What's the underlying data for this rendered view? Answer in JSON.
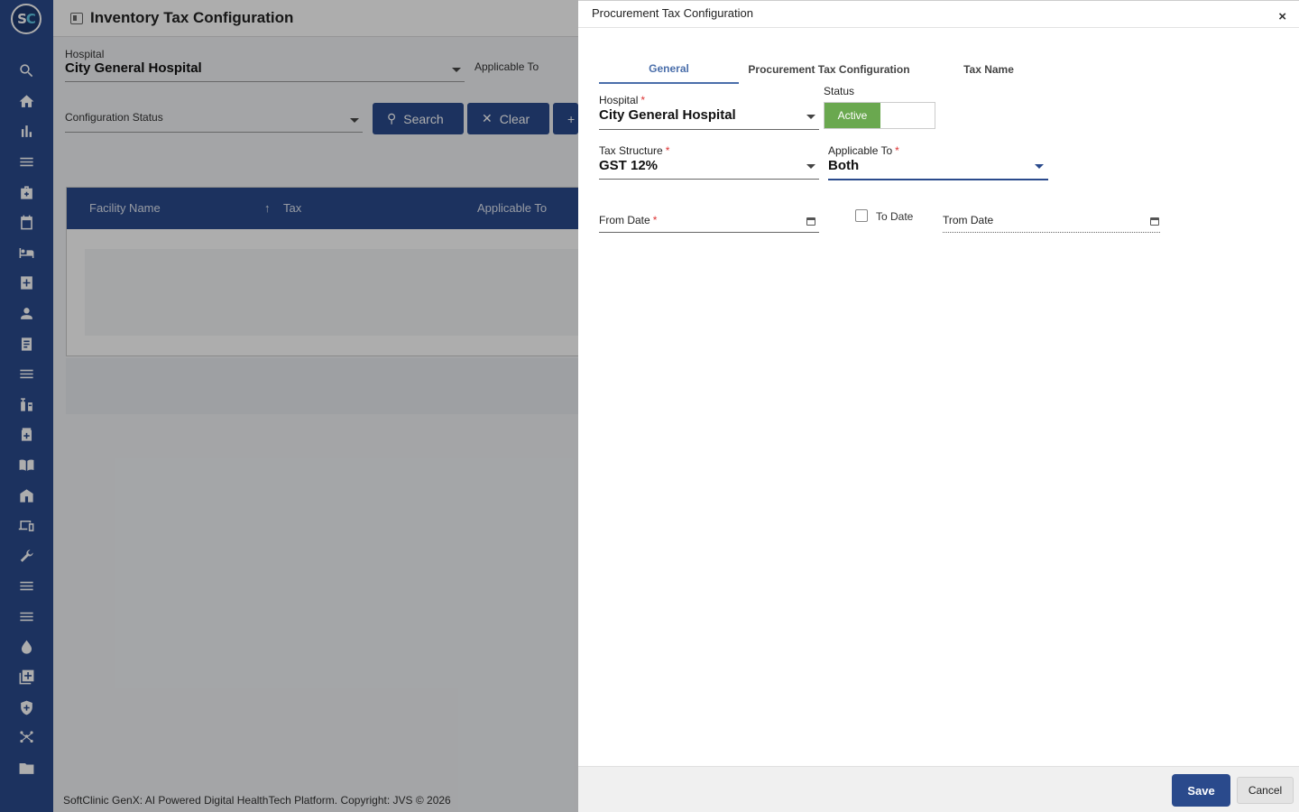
{
  "app": {
    "logo_letters": [
      "S",
      "C"
    ],
    "page_title": "Inventory Tax Configuration",
    "footer": "SoftClinic GenX: AI Powered Digital HealthTech Platform. Copyright: JVS © 2026"
  },
  "sidebar": {
    "icons": [
      "search-icon",
      "home-icon",
      "bar-chart-icon",
      "menu-icon",
      "medical-bag-icon",
      "calendar-icon",
      "bed-icon",
      "medical-plus-icon",
      "person-icon",
      "receipt-icon",
      "list-icon",
      "pharmacy-icon",
      "medicine-box-icon",
      "book-icon",
      "store-icon",
      "devices-icon",
      "wrench-icon",
      "menu-icon-2",
      "menu-icon-3",
      "drop-icon",
      "add-library-icon",
      "shield-icon",
      "network-icon",
      "folder-icon"
    ]
  },
  "filters": {
    "hospital_label": "Hospital",
    "hospital_value": "City General Hospital",
    "applicable_to_label": "Applicable To",
    "config_status_label": "Configuration Status",
    "search_label": "Search",
    "clear_label": "Clear",
    "add_label": "+"
  },
  "table": {
    "columns": [
      "Facility Name",
      "Tax",
      "Applicable To"
    ]
  },
  "drawer": {
    "title": "Procurement Tax Configuration",
    "close": "×",
    "tabs": [
      "General",
      "Procurement Tax Configuration",
      "Tax Name"
    ],
    "active_tab": "General",
    "hospital_label": "Hospital",
    "hospital_value": "City General Hospital",
    "status_label": "Status",
    "status_value": "Active",
    "tax_structure_label": "Tax Structure",
    "tax_structure_value": "GST 12%",
    "applicable_to_label": "Applicable To",
    "applicable_to_value": "Both",
    "from_date_label": "From Date",
    "to_date_label": "To Date",
    "trom_date_label": "Trom Date",
    "required_mark": "*",
    "save_label": "Save",
    "cancel_label": "Cancel"
  },
  "colors": {
    "primary": "#2a4a8c",
    "active_green": "#6aa84f",
    "tab_active": "#4a6eaa",
    "required": "#dd3333"
  }
}
